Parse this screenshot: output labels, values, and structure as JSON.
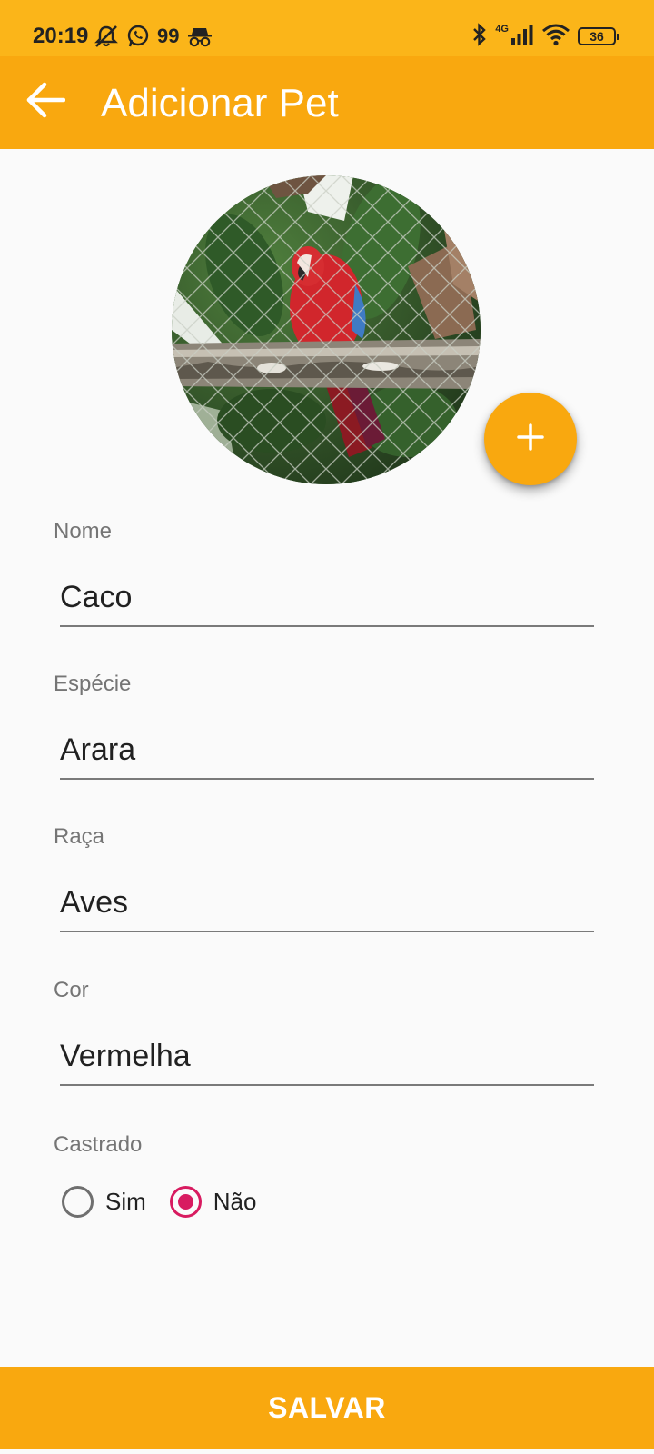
{
  "status_bar": {
    "time": "20:19",
    "left_icons": [
      "muted-bell-icon",
      "whatsapp-icon",
      "incognito-icon"
    ],
    "left_badge": "99",
    "right_icons": [
      "bluetooth-icon",
      "signal-icon",
      "wifi-icon"
    ],
    "network_label": "4G",
    "battery": "36"
  },
  "app_bar": {
    "title": "Adicionar Pet",
    "background": "#f9a80f",
    "back_icon": "arrow-back-icon"
  },
  "photo": {
    "add_icon": "plus-icon"
  },
  "form": {
    "nome": {
      "label": "Nome",
      "value": "Caco"
    },
    "especie": {
      "label": "Espécie",
      "value": "Arara"
    },
    "raca": {
      "label": "Raça",
      "value": "Aves"
    },
    "cor": {
      "label": "Cor",
      "value": "Vermelha"
    },
    "castrado": {
      "label": "Castrado",
      "options": [
        "Sim",
        "Não"
      ],
      "selected": "Não"
    }
  },
  "actions": {
    "save_label": "SALVAR"
  },
  "colors": {
    "accent": "#f9a80f",
    "status_bar": "#fbb519",
    "radio_selected": "#d81b60"
  }
}
